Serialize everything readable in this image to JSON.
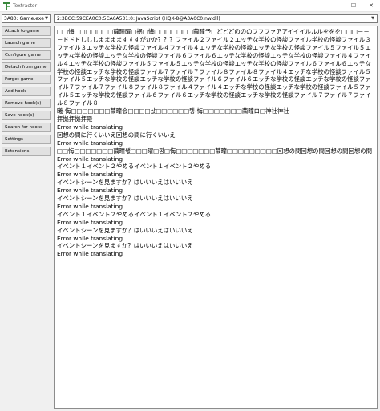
{
  "window": {
    "title": "Textractor",
    "minimize_glyph": "—",
    "maximize_glyph": "☐",
    "close_glyph": "✕"
  },
  "process_select": {
    "value": "3A80: Game.exe"
  },
  "thread_select": {
    "value": "2:3BCC:59CEA0C0:5CA6A531:0: JavaScript (HQX-8@A3A0C0:nw.dll)"
  },
  "sidebar": {
    "buttons": [
      "Attach to game",
      "Launch game",
      "Configure game",
      "Detach from game",
      "Forget game",
      "Add hook",
      "Remove hook(s)",
      "Save hook(s)",
      "Search for hooks",
      "Settings",
      "Extensions"
    ]
  },
  "text_lines": [
    "□□悔□□□□□□□繭疃曜□拐□悔□□□□□□□繭疃予□どどどのののフフファアアイイイルルルををを□□□－－－ドドドしししまままますすすがかか？？？ファイル２ファイル２エッチな学校の怪談ファイル学校の怪談ファイル３ファイル３エッチな学校の怪談ファイル４ファイル４エッチな学校の怪談エッチな学校の怪談ファイル５ファイル５エッチな学校の怪談エッチな学校の怪談ファイル６ファイル６エッチな学校の怪談エッチな学校の怪談ファイル４ファイル４エッチな学校の怪談ファイル５ファイル５エッチな学校の怪談エッチな学校の怪談ファイル６ファイル６エッチな学校の怪談エッチな学校の怪談ファイル７ファイル７ファイル８ファイル８ファイル４エッチな学校の怪談ファイル５ファイル５エッチな学校の怪談エッチな学校の怪談ファイル６ファイル６エッチな学校の怪談エッチな学校の怪談ファイル７ファイル７ファイル８ファイル８ファイル４ファイル４エッチな学校の怪談エッチな学校の怪談ファイル５ファイル５エッチな学校の怪談ファイル６ファイル６エッチな学校の怪談エッチな学校の怪談ファイル７ファイル７ファイル８ファイル８",
    "曦-悔□□□□□□□繭疃会□□□□샀□□□□□□텡-悔□□□□□□□繭疃ロ□神社神社",
    "拝拠拝拠拝殿",
    "Error while translating",
    "回想の間に行くいいえ回想の間に行くいいえ",
    "Error while translating",
    "□□悔□□□□□□□繭疃쌗□□□曜□낑□悔□□□□□□□繭疃□□□□□□□□□回想の間回想の間回想の間回想の間",
    "Error while translating",
    "イベント１イベント２やめるイベント１イベント２やめる",
    "Error while translating",
    "イベントシーンを見ますか？はいいいえはいいいえ",
    "Error while translating",
    "イベントシーンを見ますか？はいいいえはいいいえ",
    "Error while translating",
    "イベント１イベント２やめるイベント１イベント２やめる",
    "Error while translating",
    "イベントシーンを見ますか？はいいいえはいいいえ",
    "Error while translating",
    "イベントシーンを見ますか？はいいいえはいいいえ",
    "Error while translating"
  ]
}
